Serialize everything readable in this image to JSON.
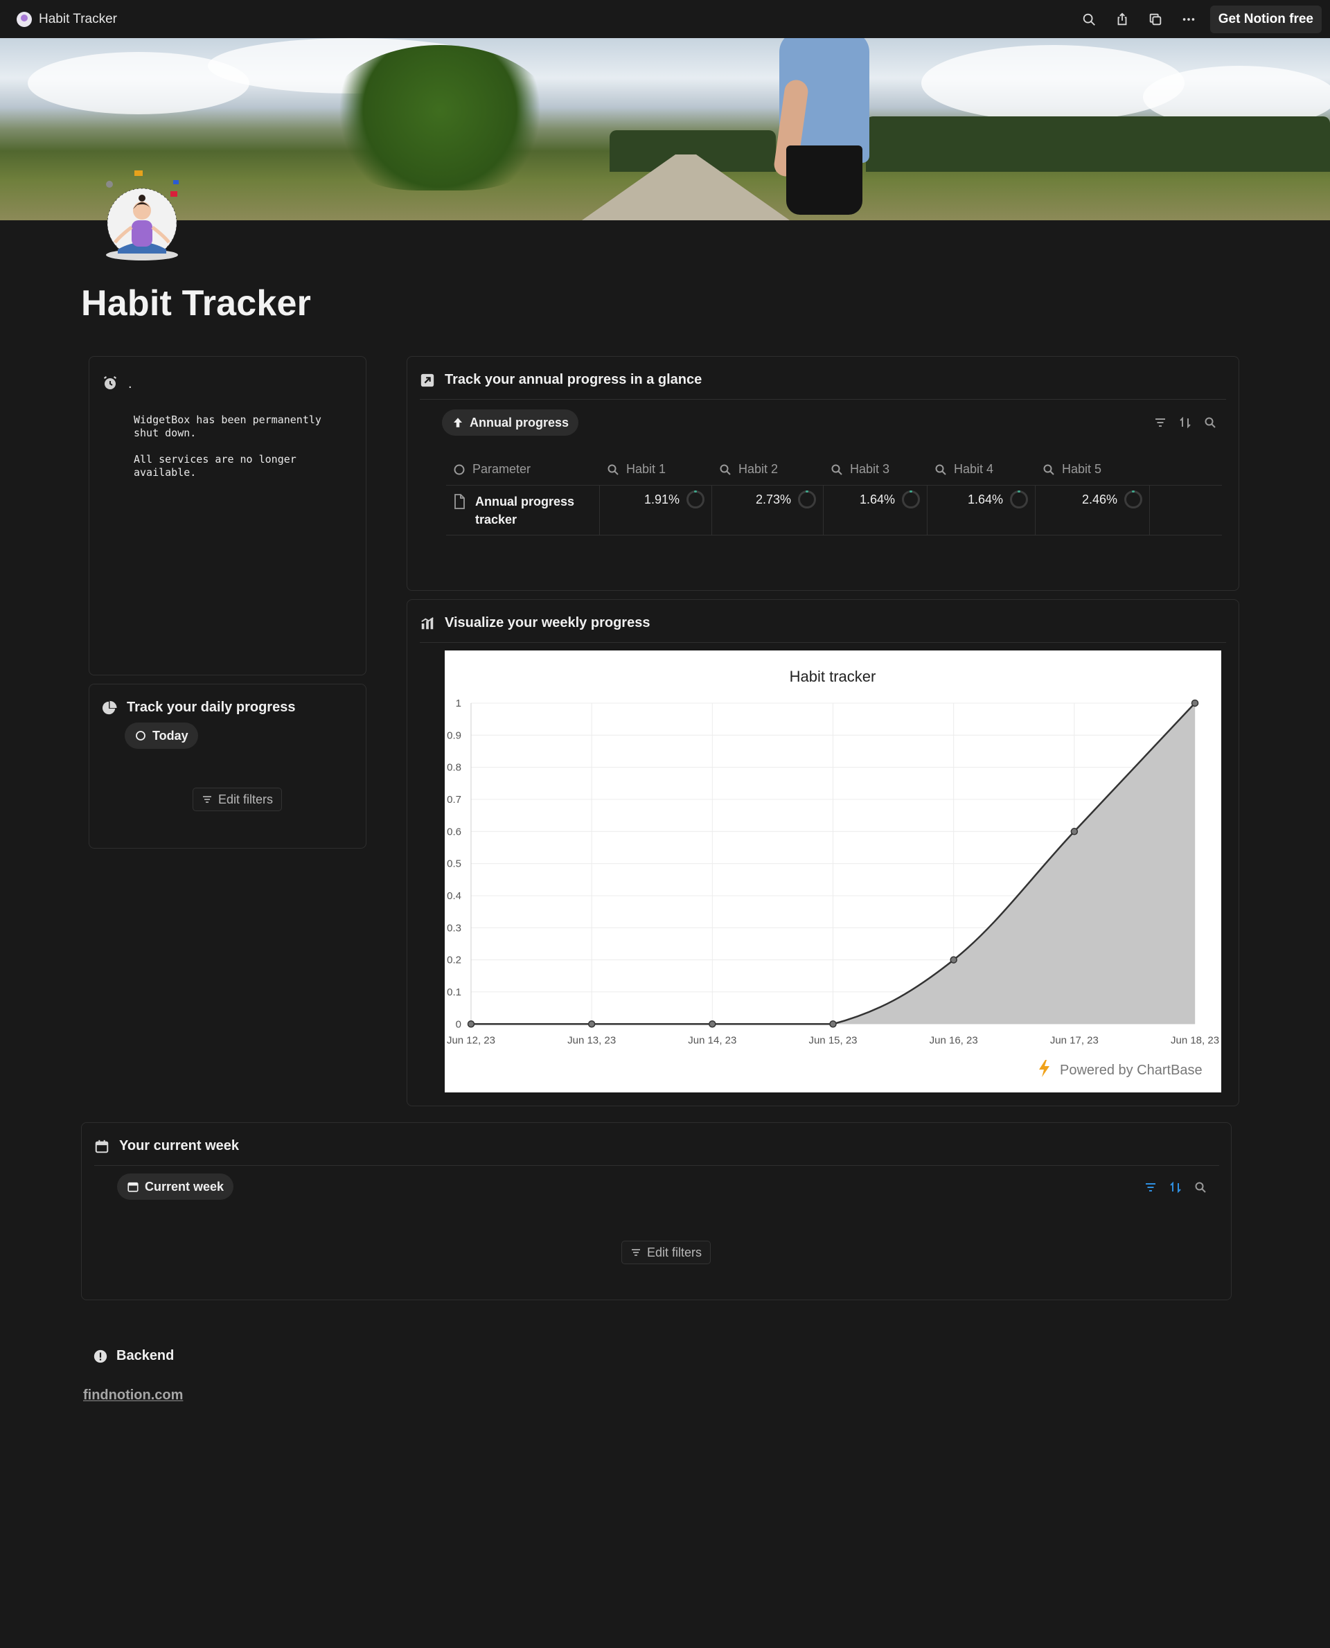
{
  "topbar": {
    "page_name": "Habit Tracker",
    "get_notion_label": "Get Notion free",
    "icons": [
      "search-icon",
      "share-icon",
      "duplicate-icon",
      "more-icon"
    ]
  },
  "page": {
    "title": "Habit Tracker"
  },
  "widget": {
    "dot": ".",
    "message": "WidgetBox has been permanently\nshut down.\n\nAll services are no longer\navailable."
  },
  "daily": {
    "heading": "Track your daily progress",
    "view_label": "Today",
    "edit_filters_label": "Edit filters"
  },
  "annual": {
    "heading": "Track your annual progress in a glance",
    "view_label": "Annual progress",
    "columns": [
      "Parameter",
      "Habit 1",
      "Habit 2",
      "Habit 3",
      "Habit 4",
      "Habit 5"
    ],
    "row": {
      "name": "Annual progress tracker",
      "values": [
        "1.91%",
        "2.73%",
        "1.64%",
        "1.64%",
        "2.46%"
      ]
    }
  },
  "weekly": {
    "heading": "Visualize your  weekly progress",
    "powered_by": "Powered by ChartBase"
  },
  "chart_data": {
    "type": "area",
    "title": "Habit tracker",
    "x": [
      "Jun 12, 23",
      "Jun 13, 23",
      "Jun 14, 23",
      "Jun 15, 23",
      "Jun 16, 23",
      "Jun 17, 23",
      "Jun 18, 23"
    ],
    "series": [
      {
        "values": [
          0,
          0,
          0,
          0,
          0.2,
          0.6,
          1
        ]
      }
    ],
    "ylim": [
      0,
      1
    ],
    "y_ticks": [
      "0",
      "0.1",
      "0.2",
      "0.3",
      "0.4",
      "0.5",
      "0.6",
      "0.7",
      "0.8",
      "0.9",
      "1"
    ],
    "grid": true,
    "line_color": "#333333",
    "fill_color": "#c6c6c6"
  },
  "current_week": {
    "heading": "Your current week",
    "view_label": "Current week",
    "edit_filters_label": "Edit filters"
  },
  "footer": {
    "backend_label": "Backend",
    "link_text": "findnotion.com"
  },
  "colors": {
    "background": "#191919",
    "accent_blue": "#2f8fe0"
  }
}
